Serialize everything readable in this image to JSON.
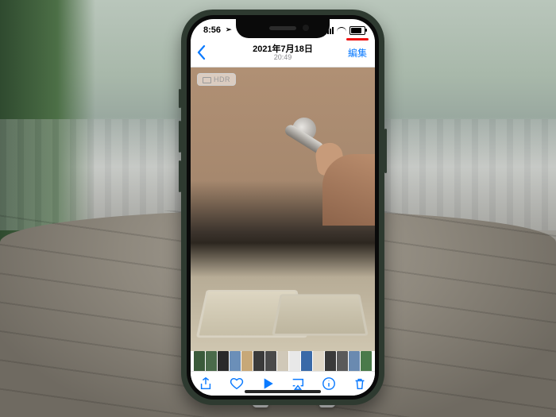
{
  "status": {
    "time": "8:56",
    "location_glyph": "➢"
  },
  "nav": {
    "title": "2021年7月18日",
    "subtitle": "20:49",
    "edit_label": "編集"
  },
  "photo": {
    "hdr_badge": "HDR"
  },
  "thumbnails": [
    {
      "color": "#3a5a3a"
    },
    {
      "color": "#4a6a4a"
    },
    {
      "color": "#2a2a2a"
    },
    {
      "color": "#6b8fb8"
    },
    {
      "color": "#c7a878"
    },
    {
      "color": "#3a3a3a"
    },
    {
      "color": "#4a4a4a"
    },
    {
      "color": "#d0c8b8"
    },
    {
      "color": "#e8e8e8"
    },
    {
      "color": "#3a6aa8"
    },
    {
      "color": "#e0d8c8"
    },
    {
      "color": "#3a3a3a"
    },
    {
      "color": "#5a5a5a"
    },
    {
      "color": "#6a8ab0"
    },
    {
      "color": "#4a7a4a"
    }
  ],
  "toolbar": {
    "share": "share-icon",
    "favorite": "heart-icon",
    "play": "play-icon",
    "airplay": "airplay-icon",
    "info": "info-icon",
    "delete": "trash-icon"
  }
}
